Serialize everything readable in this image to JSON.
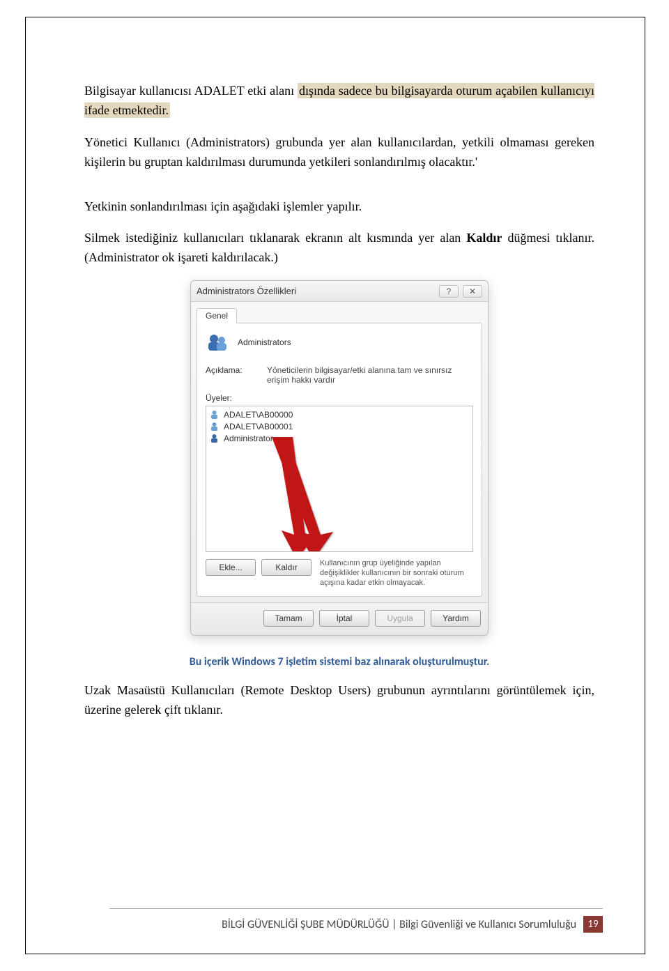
{
  "para1_pre_highlight": "     Bilgisayar kullanıcısı ADALET etki alanı ",
  "para1_highlight": "dışında sadece bu bilgisayarda oturum açabilen kullanıcıyı ifade etmektedir.",
  "para2": "Yönetici Kullanıcı (Administrators) grubunda yer alan kullanıcılardan, yetkili olmaması gereken kişilerin bu gruptan kaldırılması durumunda yetkileri sonlandırılmış olacaktır.'",
  "para3": "Yetkinin sonlandırılması için aşağıdaki işlemler yapılır.",
  "para4_a": "Silmek istediğiniz kullanıcıları tıklanarak ekranın alt kısmında yer alan ",
  "para4_b": "Kaldır",
  "para4_c": " düğmesi tıklanır. (Administrator ok işareti kaldırılacak.)",
  "dialog": {
    "title": "Administrators Özellikleri",
    "help_glyph": "?",
    "close_glyph": "✕",
    "tab": "Genel",
    "group_name": "Administrators",
    "desc_label": "Açıklama:",
    "desc_value": "Yöneticilerin bilgisayar/etki alanına tam ve sınırsız erişim hakkı vardır",
    "members_label": "Üyeler:",
    "members": [
      "ADALET\\AB00000",
      "ADALET\\AB00001",
      "Administrator"
    ],
    "add": "Ekle...",
    "remove": "Kaldır",
    "hint": "Kullanıcının grup üyeliğinde yapılan değişiklikler kullanıcının bir sonraki oturum açışına kadar etkin olmayacak.",
    "ok": "Tamam",
    "cancel": "İptal",
    "apply": "Uygula",
    "helpbtn": "Yardım"
  },
  "caption": "Bu içerik  Windows 7 işletim sistemi baz alınarak oluşturulmuştur.",
  "para5": "Uzak Masaüstü Kullanıcıları (Remote Desktop Users) grubunun ayrıntılarını görüntülemek için, üzerine gelerek çift tıklanır.",
  "footer": {
    "text": "BİLGİ GÜVENLİĞİ ŞUBE MÜDÜRLÜĞÜ | Bilgi Güvenliği ve Kullanıcı Sorumluluğu",
    "page": "19"
  }
}
